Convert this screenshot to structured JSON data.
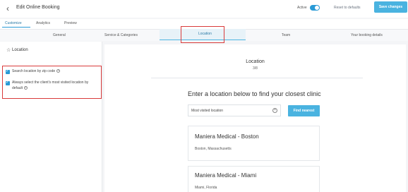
{
  "header": {
    "title": "Edit Online Booking",
    "active_label": "Active",
    "reset_label": "Reset to defaults",
    "save_label": "Save changes"
  },
  "top_tabs": [
    "Customize",
    "Analytics",
    "Preview"
  ],
  "sub_tabs": [
    "General",
    "Service & Categories",
    "Location",
    "Team",
    "Your booking details"
  ],
  "left_panel": {
    "title": "Location",
    "options": [
      {
        "label": "Search location by zip code",
        "checked": true
      },
      {
        "label_line1": "Always select the client's most visited location by",
        "label_line2": "default",
        "checked": true
      }
    ]
  },
  "main": {
    "title": "Location",
    "step": "3/8",
    "prompt": "Enter a location below to find your closest clinic",
    "search_value": "Most visited location",
    "find_label": "Find nearest",
    "locations": [
      {
        "name": "Maniera Medical - Boston",
        "city": "Boston, Massachusetts"
      },
      {
        "name": "Maniera Medical - Miami",
        "city": "Miami, Florida"
      }
    ]
  },
  "colors": {
    "accent": "#4ab3e0",
    "highlight": "#d93b3b"
  }
}
